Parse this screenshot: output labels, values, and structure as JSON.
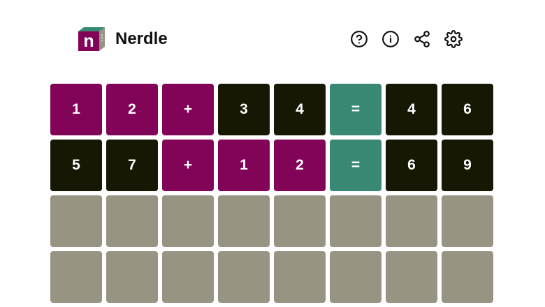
{
  "app": {
    "title": "Nerdle",
    "logo_letter": "n",
    "logo_colors": {
      "front": "#820458",
      "top": "#398874",
      "side": "#989484"
    }
  },
  "header_icons": [
    {
      "name": "help-icon",
      "glyph": "?"
    },
    {
      "name": "info-icon",
      "glyph": "i"
    },
    {
      "name": "share-icon",
      "glyph": "share"
    },
    {
      "name": "settings-icon",
      "glyph": "gear"
    }
  ],
  "colors": {
    "present": "#820458",
    "absent": "#161803",
    "correct": "#398874",
    "empty": "#989484"
  },
  "board": {
    "columns": 8,
    "rows": [
      {
        "tiles": [
          {
            "char": "1",
            "state": "present"
          },
          {
            "char": "2",
            "state": "present"
          },
          {
            "char": "+",
            "state": "present"
          },
          {
            "char": "3",
            "state": "absent"
          },
          {
            "char": "4",
            "state": "absent"
          },
          {
            "char": "=",
            "state": "correct"
          },
          {
            "char": "4",
            "state": "absent"
          },
          {
            "char": "6",
            "state": "absent"
          }
        ]
      },
      {
        "tiles": [
          {
            "char": "5",
            "state": "absent"
          },
          {
            "char": "7",
            "state": "absent"
          },
          {
            "char": "+",
            "state": "present"
          },
          {
            "char": "1",
            "state": "present"
          },
          {
            "char": "2",
            "state": "present"
          },
          {
            "char": "=",
            "state": "correct"
          },
          {
            "char": "6",
            "state": "absent"
          },
          {
            "char": "9",
            "state": "absent"
          }
        ]
      },
      {
        "tiles": [
          {
            "char": "",
            "state": "empty"
          },
          {
            "char": "",
            "state": "empty"
          },
          {
            "char": "",
            "state": "empty"
          },
          {
            "char": "",
            "state": "empty"
          },
          {
            "char": "",
            "state": "empty"
          },
          {
            "char": "",
            "state": "empty"
          },
          {
            "char": "",
            "state": "empty"
          },
          {
            "char": "",
            "state": "empty"
          }
        ]
      },
      {
        "tiles": [
          {
            "char": "",
            "state": "empty"
          },
          {
            "char": "",
            "state": "empty"
          },
          {
            "char": "",
            "state": "empty"
          },
          {
            "char": "",
            "state": "empty"
          },
          {
            "char": "",
            "state": "empty"
          },
          {
            "char": "",
            "state": "empty"
          },
          {
            "char": "",
            "state": "empty"
          },
          {
            "char": "",
            "state": "empty"
          }
        ]
      }
    ]
  }
}
